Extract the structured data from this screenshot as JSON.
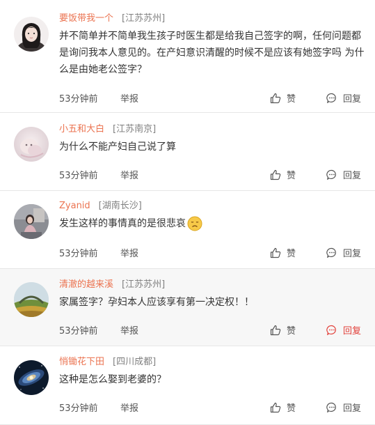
{
  "comments": [
    {
      "username": "要饭带我一个",
      "location": "[江苏苏州]",
      "text": "并不简单并不简单我生孩子时医生都是给我自己签字的啊，任何问题都是询问我本人意见的。在产妇意识清醒的时候不是应该有她签字吗 为什么是由她老公签字？",
      "time": "53分钟前",
      "report": "举报",
      "like": "赞",
      "reply": "回复"
    },
    {
      "username": "小五和大白",
      "location": "[江苏南京]",
      "text": "为什么不能产妇自己说了算",
      "time": "53分钟前",
      "report": "举报",
      "like": "赞",
      "reply": "回复"
    },
    {
      "username": "Zyanid",
      "location": "[湖南长沙]",
      "text": "发生这样的事情真的是很悲哀",
      "emoji": "sad-face-emoji",
      "time": "53分钟前",
      "report": "举报",
      "like": "赞",
      "reply": "回复"
    },
    {
      "username": "清澈的越来溪",
      "location": "[江苏苏州]",
      "text": "家属签字？孕妇本人应该享有第一决定权！！",
      "time": "53分钟前",
      "report": "举报",
      "like": "赞",
      "reply": "回复",
      "reply_active": true
    },
    {
      "username": "悄锄花下田",
      "location": "[四川成都]",
      "text": "这种是怎么娶到老婆的？",
      "time": "53分钟前",
      "report": "举报",
      "like": "赞",
      "reply": "回复"
    }
  ],
  "colors": {
    "username": "#eb7350",
    "location": "#808080",
    "reply_active": "#e2403a",
    "hover_background": "#f7f7f7",
    "divider": "#e6e6e6"
  }
}
